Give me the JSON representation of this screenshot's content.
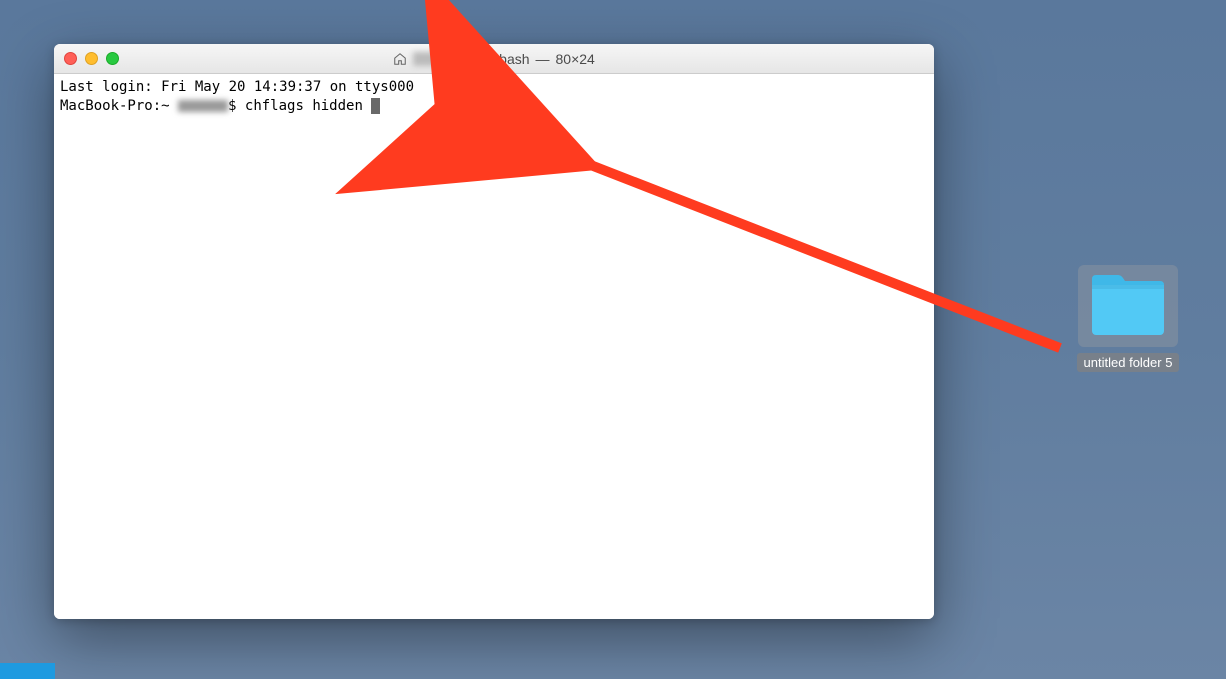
{
  "window": {
    "title_user_blurred": true,
    "title_app": "bash",
    "title_size": "80×24"
  },
  "terminal": {
    "last_login_line": "Last login: Fri May 20 14:39:37 on ttys000",
    "prompt_host": "MacBook-Pro:~",
    "prompt_user_blurred": true,
    "prompt_symbol": "$",
    "command_typed": "chflags hidden "
  },
  "desktop_folder": {
    "label": "untitled folder 5",
    "selected": true
  },
  "icons": {
    "home": "home-icon",
    "scroll_indicator": "lines-icon"
  }
}
